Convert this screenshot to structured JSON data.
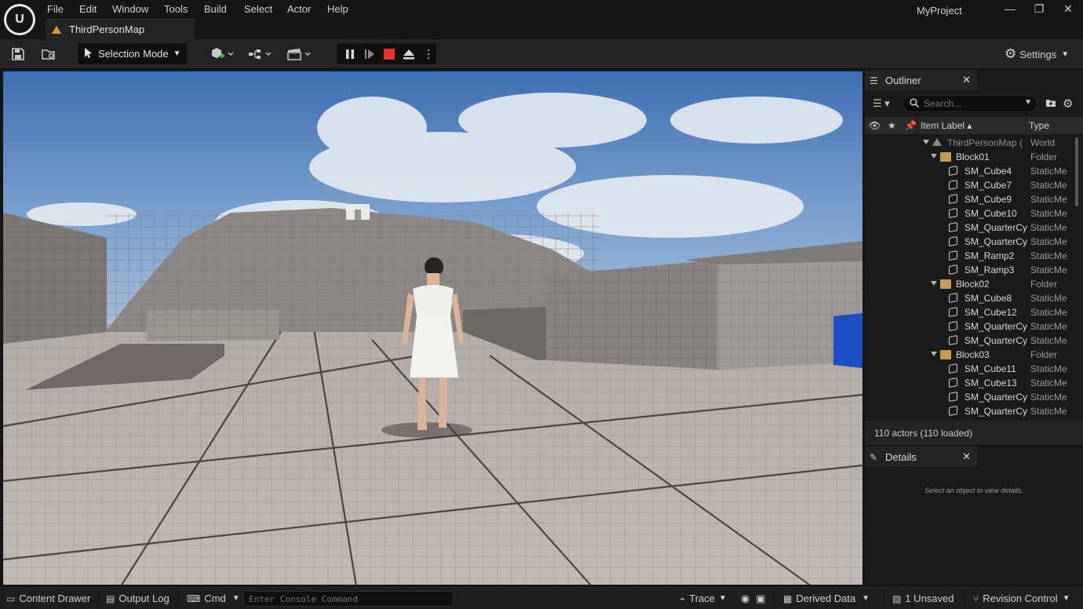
{
  "menu": {
    "items": [
      "File",
      "Edit",
      "Window",
      "Tools",
      "Build",
      "Select",
      "Actor",
      "Help"
    ]
  },
  "window": {
    "project_name": "MyProject",
    "minimize": "—",
    "restore": "❐",
    "close": "✕"
  },
  "tab": {
    "label": "ThirdPersonMap"
  },
  "toolbar": {
    "selection_mode": "Selection Mode",
    "settings": "Settings"
  },
  "outliner": {
    "title": "Outliner",
    "search_placeholder": "Search...",
    "columns": {
      "label": "Item Label ▴",
      "type": "Type"
    },
    "rows": [
      {
        "label": "ThirdPersonMap (",
        "type": "World",
        "kind": "world",
        "depth": 0
      },
      {
        "label": "Block01",
        "type": "Folder",
        "kind": "folder",
        "depth": 1
      },
      {
        "label": "SM_Cube4",
        "type": "StaticMe",
        "kind": "mesh",
        "depth": 2
      },
      {
        "label": "SM_Cube7",
        "type": "StaticMe",
        "kind": "mesh",
        "depth": 2
      },
      {
        "label": "SM_Cube9",
        "type": "StaticMe",
        "kind": "mesh",
        "depth": 2
      },
      {
        "label": "SM_Cube10",
        "type": "StaticMe",
        "kind": "mesh",
        "depth": 2
      },
      {
        "label": "SM_QuarterCy",
        "type": "StaticMe",
        "kind": "mesh",
        "depth": 2
      },
      {
        "label": "SM_QuarterCy",
        "type": "StaticMe",
        "kind": "mesh",
        "depth": 2
      },
      {
        "label": "SM_Ramp2",
        "type": "StaticMe",
        "kind": "mesh",
        "depth": 2
      },
      {
        "label": "SM_Ramp3",
        "type": "StaticMe",
        "kind": "mesh",
        "depth": 2
      },
      {
        "label": "Block02",
        "type": "Folder",
        "kind": "folder",
        "depth": 1
      },
      {
        "label": "SM_Cube8",
        "type": "StaticMe",
        "kind": "mesh",
        "depth": 2
      },
      {
        "label": "SM_Cube12",
        "type": "StaticMe",
        "kind": "mesh",
        "depth": 2
      },
      {
        "label": "SM_QuarterCy",
        "type": "StaticMe",
        "kind": "mesh",
        "depth": 2
      },
      {
        "label": "SM_QuarterCy",
        "type": "StaticMe",
        "kind": "mesh",
        "depth": 2
      },
      {
        "label": "Block03",
        "type": "Folder",
        "kind": "folder",
        "depth": 1
      },
      {
        "label": "SM_Cube11",
        "type": "StaticMe",
        "kind": "mesh",
        "depth": 2
      },
      {
        "label": "SM_Cube13",
        "type": "StaticMe",
        "kind": "mesh",
        "depth": 2
      },
      {
        "label": "SM_QuarterCy",
        "type": "StaticMe",
        "kind": "mesh",
        "depth": 2
      },
      {
        "label": "SM_QuarterCy",
        "type": "StaticMe",
        "kind": "mesh",
        "depth": 2
      }
    ],
    "actor_count": "110 actors (110 loaded)"
  },
  "details": {
    "title": "Details",
    "hint": "Select an object to view details."
  },
  "statusbar": {
    "content_drawer": "Content Drawer",
    "output_log": "Output Log",
    "cmd": "Cmd",
    "console_placeholder": "Enter Console Command",
    "trace": "Trace",
    "derived_data": "Derived Data",
    "unsaved": "1 Unsaved",
    "revision_control": "Revision Control"
  },
  "colors": {
    "accent_blue": "#2f74d8",
    "stop_red": "#e8322b",
    "folder": "#c49a55",
    "tab_icon": "#e39a2a"
  }
}
